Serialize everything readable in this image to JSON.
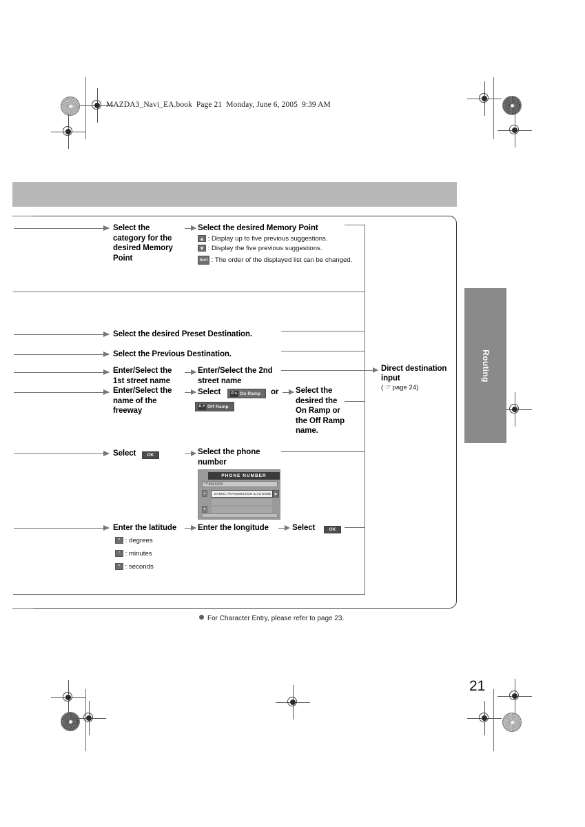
{
  "header": {
    "book_line": "MAZDA3_Navi_EA.book  Page 21  Monday, June 6, 2005  9:39 AM"
  },
  "side_tab": {
    "label": "Routing"
  },
  "page_number": "21",
  "footer": {
    "note": "For Character Entry, please refer to page 23."
  },
  "flow": {
    "memory_point": {
      "col1": "Select the\ncategory for the\ndesired  Memory\nPoint",
      "col2_title": "Select the desired Memory Point",
      "notes": [
        {
          "key": "▲",
          "key_name": "up-arrow-key",
          "text": ": Display up to five previous suggestions."
        },
        {
          "key": "▼",
          "key_name": "down-arrow-key",
          "text": ": Display the five previous suggestions."
        },
        {
          "key": "Sort",
          "key_name": "sort-key",
          "text": ": The order of the displayed list can be changed."
        }
      ]
    },
    "preset_destination": {
      "label": "Select the desired Preset Destination."
    },
    "previous_destination": {
      "label": "Select the Previous Destination."
    },
    "street": {
      "col1": "Enter/Select the\n1st street name",
      "col2": "Enter/Select the 2nd\nstreet name"
    },
    "freeway": {
      "col1": "Enter/Select the\nname of the\nfreeway",
      "col2_select": "Select",
      "on_ramp_label": "On Ramp",
      "on_ramp_icon": "A↘",
      "or": "or",
      "off_ramp_label": "Off Ramp",
      "off_ramp_icon": "A↗",
      "col3": "Select the\ndesired the\nOn Ramp or\nthe Off Ramp\nname."
    },
    "poi_ok": {
      "select_label": "Select",
      "ok_label": "OK"
    },
    "phone": {
      "col2": "Select the phone\nnumber",
      "panel": {
        "title": "PHONE NUMBER",
        "input_value": "***4563333",
        "selected_row": "DANIEL TRANSMISSION & ALIGNMEN",
        "up_key": "▲",
        "down_key": "▼",
        "next_key": "▶"
      }
    },
    "coordinates": {
      "latitude": "Enter the latitude",
      "longitude": "Enter the longitude",
      "select_label": "Select",
      "ok_label": "OK",
      "notes": [
        {
          "key": "°",
          "key_name": "degrees-key",
          "text": ": degrees"
        },
        {
          "key": "′",
          "key_name": "minutes-key",
          "text": ": minutes"
        },
        {
          "key": "″",
          "key_name": "seconds-key",
          "text": ": seconds"
        }
      ]
    },
    "direct_input": {
      "line1": "Direct destination",
      "line2": "input",
      "ref_open": "( ",
      "ref_text": "page 24)"
    }
  }
}
